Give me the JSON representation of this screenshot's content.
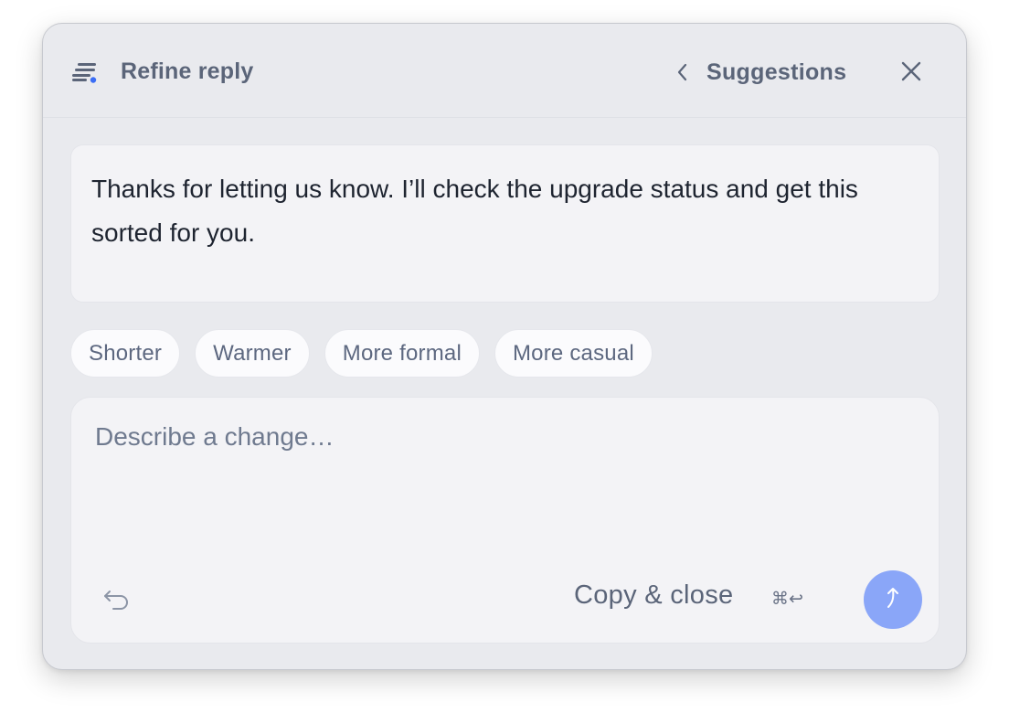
{
  "header": {
    "title": "Refine reply",
    "title_icon": "text-lines-icon",
    "suggestions_label": "Suggestions",
    "back_icon": "chevron-left-icon",
    "close_icon": "close-icon"
  },
  "reply": {
    "text": "Thanks for letting us know. I’ll check the upgrade status and get this sorted for you."
  },
  "chips": [
    {
      "label": "Shorter"
    },
    {
      "label": "Warmer"
    },
    {
      "label": "More formal"
    },
    {
      "label": "More casual"
    }
  ],
  "composer": {
    "placeholder": "Describe a change…",
    "value": "",
    "undo_icon": "undo-icon",
    "copy_close_label": "Copy & close",
    "shortcut": "⌘↩",
    "send_icon": "send-arrow-icon"
  },
  "colors": {
    "panel_bg": "#e9eaee",
    "accent": "#8aa6f8",
    "icon_dot": "#3b6ef5",
    "text_primary": "#1e2430",
    "text_muted": "#5b6579"
  }
}
